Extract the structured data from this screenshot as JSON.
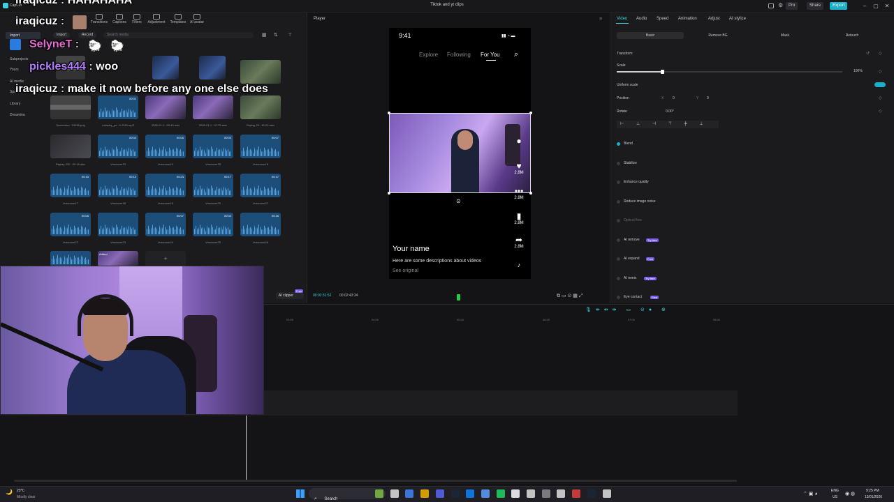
{
  "window": {
    "title": "Tiktok and yt clips",
    "app_name": "CapCut",
    "pro_label": "Pro",
    "share_label": "Share",
    "export_label": "Export"
  },
  "toolbar": {
    "tools": [
      "Import",
      "Text",
      "Stickers",
      "Transitions",
      "Captions",
      "Filters",
      "Adjustment",
      "Templates",
      "AI avatar"
    ]
  },
  "media": {
    "import_label": "Import",
    "record_label": "Record",
    "search_placeholder": "Search media",
    "sidebar": [
      "Import",
      "Subprojects",
      "Yours",
      "AI media",
      "Spaces",
      "Library",
      "Dreamina"
    ],
    "items": [
      {
        "label": "Screensho...24935.png",
        "kind": "screen",
        "dur": ""
      },
      {
        "label": "cobwzty_po...h.2019.mp3",
        "kind": "audio",
        "dur": "00:01"
      },
      {
        "label": "2026-01-1...05-40.mkv",
        "kind": "video",
        "dur": ""
      },
      {
        "label": "2026-01-1...07-33.mkv",
        "kind": "video",
        "dur": ""
      },
      {
        "label": "Replay 20...40-02.mkv",
        "kind": "nature",
        "dur": ""
      },
      {
        "label": "Replay 202...49-18.mkv",
        "kind": "dark",
        "dur": ""
      },
      {
        "label": "Voiceover13",
        "kind": "audio",
        "dur": "00:04"
      },
      {
        "label": "Voiceover14",
        "kind": "audio",
        "dur": "00:05"
      },
      {
        "label": "Voiceover15",
        "kind": "audio",
        "dur": "00:03"
      },
      {
        "label": "Voiceover16",
        "kind": "audio",
        "dur": "00:07"
      },
      {
        "label": "Voiceover17",
        "kind": "audio",
        "dur": "00:10"
      },
      {
        "label": "Voiceover18",
        "kind": "audio",
        "dur": "00:12"
      },
      {
        "label": "Voiceover19",
        "kind": "audio",
        "dur": "00:23"
      },
      {
        "label": "Voiceover20",
        "kind": "audio",
        "dur": "00:17"
      },
      {
        "label": "Voiceover21",
        "kind": "audio",
        "dur": "00:17"
      },
      {
        "label": "Voiceover22",
        "kind": "audio",
        "dur": "00:05"
      },
      {
        "label": "Voiceover23",
        "kind": "audio",
        "dur": ""
      },
      {
        "label": "Voiceover24",
        "kind": "audio",
        "dur": "00:07"
      },
      {
        "label": "Voiceover25",
        "kind": "audio",
        "dur": "00:04"
      },
      {
        "label": "Voiceover26",
        "kind": "audio",
        "dur": "00:16"
      }
    ],
    "added_label": "Added",
    "ai_clipper_label": "AI clipper",
    "free_badge": "Free"
  },
  "chat": [
    {
      "user": "iraqicuz",
      "message": "HAHAHAHA",
      "color": "#ffffff"
    },
    {
      "user": "iraqicuz",
      "message": "",
      "color": "#ffffff"
    },
    {
      "user": "SelyneT",
      "message": "",
      "color": "#e86ad2"
    },
    {
      "user": "pickles444",
      "message": "woo",
      "color": "#b47cff"
    },
    {
      "user": "iraqicuz",
      "message": "make it now before any one else does",
      "color": "#ffffff"
    }
  ],
  "player": {
    "label": "Player",
    "phone_time": "9:41",
    "tabs": [
      "Explore",
      "Following",
      "For You"
    ],
    "active_tab": "For You",
    "side_counts": [
      "2.8M",
      "2.8M",
      "2.8M",
      "2.8M"
    ],
    "your_name": "Your name",
    "description": "Here are some descriptions about videos",
    "see_original": "See original",
    "current_time": "00:02:31:52",
    "total_time": "00:02:43:34"
  },
  "props": {
    "tabs": [
      "Video",
      "Audio",
      "Speed",
      "Animation",
      "Adjust",
      "AI stylize"
    ],
    "active_tab": "Video",
    "subtabs": [
      "Basic",
      "Remove BG",
      "Mask",
      "Retouch"
    ],
    "active_subtab": "Basic",
    "transform_label": "Transform",
    "scale_label": "Scale",
    "scale_value": "100%",
    "scale_fraction": 0.2,
    "uniform_scale_label": "Uniform scale",
    "position_label": "Position",
    "pos_x_label": "X",
    "pos_x": "0",
    "pos_y_label": "Y",
    "pos_y": "0",
    "rotate_label": "Rotate",
    "rotate_value": "0.00°",
    "sections": [
      {
        "label": "Blend",
        "badge": "",
        "on": true
      },
      {
        "label": "Stabilize",
        "badge": "",
        "on": false
      },
      {
        "label": "Enhance quality",
        "badge": "",
        "on": false
      },
      {
        "label": "Reduce image noise",
        "badge": "",
        "on": false
      },
      {
        "label": "Optical flow",
        "badge": "",
        "on": false
      },
      {
        "label": "AI remove",
        "badge": "Try free",
        "on": false
      },
      {
        "label": "AI expand",
        "badge": "Free",
        "on": false
      },
      {
        "label": "AI remix",
        "badge": "Try free",
        "on": false
      },
      {
        "label": "Eye contact",
        "badge": "Free",
        "on": false
      }
    ]
  },
  "timeline": {
    "ruler": [
      "03:00",
      "04:00",
      "05:00",
      "06:00",
      "07:00",
      "08:00"
    ]
  },
  "taskbar": {
    "weather_temp": "23°C",
    "weather_desc": "Mostly clear",
    "search_label": "Search",
    "lang_top": "ENG",
    "lang_bottom": "US",
    "time": "9:25 PM",
    "date": "13/01/2026"
  }
}
